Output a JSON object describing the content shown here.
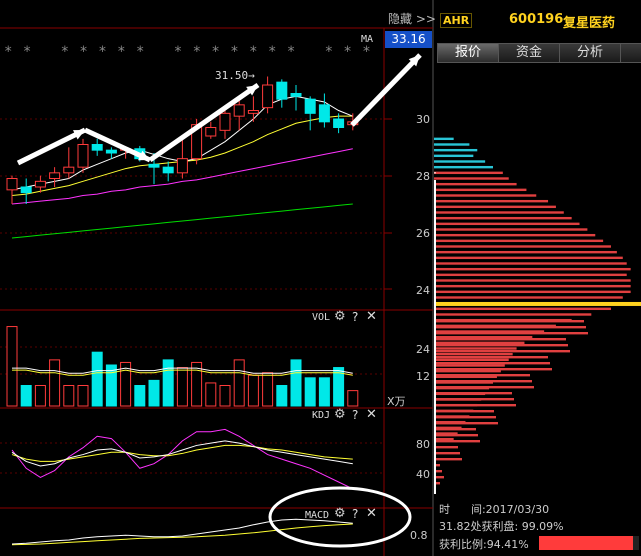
{
  "topbar": {
    "hide_button": "隐藏 >>"
  },
  "chart": {
    "stars": "* *   * * * * *   * * * * * * *   * * *",
    "ma_label": "MA",
    "price_badge": "33.16",
    "peak_label": "31.50→"
  },
  "price_axis": [
    "30",
    "28",
    "26",
    "24"
  ],
  "vol_axis": [
    "24",
    "12"
  ],
  "vol_unit": "X万",
  "kdj_axis": [
    "80",
    "40"
  ],
  "macd_axis": "0.8",
  "indicators": {
    "vol": "VOL",
    "kdj": "KDJ",
    "macd": "MACD",
    "help": "?",
    "close": "✕"
  },
  "stock": {
    "badge": "AHR",
    "code": "600196",
    "name": "复星医药"
  },
  "tabs": [
    "报价",
    "资金",
    "分析"
  ],
  "info": {
    "time_label": "时      间:2017/03/30",
    "profit_line": "31.82处获利盘: 99.09%",
    "ratio_line": "获利比例:94.41%"
  },
  "colors": {
    "up": "#ff3b3b",
    "down": "#00e8e8",
    "ma1": "#ffffff",
    "ma2": "#ffff33",
    "ma3": "#ff33ff",
    "ma4": "#00dd00",
    "accent": "#1550c8"
  },
  "chart_data": {
    "type": "candlestick",
    "candles": [
      {
        "o": 27.5,
        "h": 28.0,
        "l": 27.0,
        "c": 27.9
      },
      {
        "o": 27.6,
        "h": 27.9,
        "l": 27.0,
        "c": 27.4
      },
      {
        "o": 27.6,
        "h": 28.0,
        "l": 27.4,
        "c": 27.8
      },
      {
        "o": 27.9,
        "h": 28.3,
        "l": 27.6,
        "c": 28.1
      },
      {
        "o": 28.1,
        "h": 29.0,
        "l": 27.9,
        "c": 28.3
      },
      {
        "o": 28.3,
        "h": 29.3,
        "l": 28.1,
        "c": 29.1
      },
      {
        "o": 29.1,
        "h": 29.3,
        "l": 28.7,
        "c": 28.9
      },
      {
        "o": 28.9,
        "h": 29.0,
        "l": 28.6,
        "c": 28.8
      },
      {
        "o": 28.9,
        "h": 29.0,
        "l": 28.6,
        "c": 28.95
      },
      {
        "o": 28.95,
        "h": 29.05,
        "l": 28.5,
        "c": 28.6
      },
      {
        "o": 28.4,
        "h": 28.8,
        "l": 27.7,
        "c": 28.3
      },
      {
        "o": 28.3,
        "h": 28.5,
        "l": 27.8,
        "c": 28.1
      },
      {
        "o": 28.1,
        "h": 29.3,
        "l": 27.9,
        "c": 28.6
      },
      {
        "o": 28.6,
        "h": 30.0,
        "l": 28.4,
        "c": 29.8
      },
      {
        "o": 29.4,
        "h": 29.9,
        "l": 29.3,
        "c": 29.7
      },
      {
        "o": 29.6,
        "h": 30.3,
        "l": 29.3,
        "c": 30.2
      },
      {
        "o": 30.1,
        "h": 30.7,
        "l": 29.6,
        "c": 30.5
      },
      {
        "o": 30.2,
        "h": 30.8,
        "l": 29.9,
        "c": 30.3
      },
      {
        "o": 30.4,
        "h": 31.5,
        "l": 30.2,
        "c": 31.2
      },
      {
        "o": 31.3,
        "h": 31.4,
        "l": 30.4,
        "c": 30.7
      },
      {
        "o": 30.9,
        "h": 31.2,
        "l": 30.3,
        "c": 30.8
      },
      {
        "o": 30.7,
        "h": 30.8,
        "l": 29.6,
        "c": 30.2
      },
      {
        "o": 30.5,
        "h": 30.9,
        "l": 29.7,
        "c": 29.9
      },
      {
        "o": 30.0,
        "h": 30.2,
        "l": 29.5,
        "c": 29.7
      },
      {
        "o": 29.8,
        "h": 30.2,
        "l": 29.6,
        "c": 29.9
      }
    ],
    "ma5": [
      27.5,
      27.6,
      27.7,
      27.8,
      27.9,
      28.2,
      28.4,
      28.6,
      28.8,
      28.9,
      28.75,
      28.6,
      28.5,
      28.6,
      28.9,
      29.2,
      29.6,
      30.0,
      30.5,
      30.7,
      30.8,
      30.7,
      30.6,
      30.3,
      30.1
    ],
    "ma10": [
      27.3,
      27.35,
      27.45,
      27.55,
      27.65,
      27.8,
      27.95,
      28.1,
      28.25,
      28.35,
      28.4,
      28.45,
      28.5,
      28.55,
      28.65,
      28.8,
      29.0,
      29.2,
      29.45,
      29.65,
      29.85,
      29.95,
      30.05,
      30.1,
      30.1
    ],
    "ma20": [
      27.0,
      27.05,
      27.1,
      27.15,
      27.2,
      27.3,
      27.35,
      27.45,
      27.5,
      27.6,
      27.65,
      27.7,
      27.8,
      27.85,
      27.95,
      28.05,
      28.15,
      28.25,
      28.35,
      28.45,
      28.55,
      28.65,
      28.75,
      28.85,
      28.95
    ],
    "ma60": [
      25.8,
      25.85,
      25.9,
      25.95,
      26.0,
      26.05,
      26.1,
      26.15,
      26.2,
      26.25,
      26.3,
      26.35,
      26.4,
      26.45,
      26.5,
      26.55,
      26.6,
      26.65,
      26.7,
      26.75,
      26.8,
      26.85,
      26.9,
      26.95,
      27.0
    ],
    "volume": [
      31,
      8,
      8,
      18,
      8,
      8,
      21,
      16,
      17,
      8,
      10,
      18,
      15,
      17,
      9,
      8,
      18,
      12,
      13,
      8,
      18,
      11,
      11,
      15,
      6
    ],
    "vol_ma": [
      14,
      14,
      13,
      13,
      12,
      12,
      13,
      13,
      14,
      13,
      13,
      14,
      14,
      14,
      13,
      13,
      13,
      12,
      12,
      12,
      13,
      13,
      13,
      13,
      12
    ],
    "kdj_k": [
      60,
      52,
      48,
      50,
      55,
      58,
      62,
      63,
      60,
      55,
      56,
      58,
      62,
      66,
      68,
      70,
      68,
      65,
      62,
      60,
      58,
      56,
      54,
      52,
      50
    ],
    "kdj_d": [
      58,
      54,
      52,
      52,
      54,
      56,
      58,
      60,
      60,
      58,
      57,
      57,
      59,
      62,
      64,
      66,
      66,
      65,
      63,
      62,
      60,
      58,
      56,
      55,
      54
    ],
    "kdj_j": [
      62,
      46,
      38,
      44,
      56,
      64,
      74,
      72,
      60,
      46,
      50,
      58,
      70,
      78,
      78,
      80,
      74,
      66,
      58,
      54,
      50,
      46,
      40,
      34,
      28
    ],
    "macd_dif": [
      0.2,
      0.22,
      0.25,
      0.28,
      0.3,
      0.35,
      0.38,
      0.4,
      0.42,
      0.4,
      0.38,
      0.38,
      0.4,
      0.45,
      0.5,
      0.55,
      0.6,
      0.68,
      0.75,
      0.8,
      0.82,
      0.8,
      0.78,
      0.75,
      0.72
    ],
    "macd_dea": [
      0.18,
      0.19,
      0.2,
      0.22,
      0.24,
      0.26,
      0.28,
      0.3,
      0.32,
      0.34,
      0.35,
      0.36,
      0.37,
      0.38,
      0.4,
      0.42,
      0.45,
      0.48,
      0.52,
      0.56,
      0.6,
      0.63,
      0.66,
      0.68,
      0.7
    ],
    "chip_distribution": [
      {
        "price": 29.3,
        "v": 0.1,
        "type": "cyan"
      },
      {
        "price": 29.1,
        "v": 0.18,
        "type": "cyan"
      },
      {
        "price": 28.9,
        "v": 0.22,
        "type": "cyan"
      },
      {
        "price": 28.7,
        "v": 0.2,
        "type": "cyan"
      },
      {
        "price": 28.5,
        "v": 0.26,
        "type": "cyan"
      },
      {
        "price": 28.3,
        "v": 0.3,
        "type": "cyan"
      },
      {
        "price": 28.1,
        "v": 0.35,
        "type": "red"
      },
      {
        "price": 27.9,
        "v": 0.38,
        "type": "red"
      },
      {
        "price": 27.7,
        "v": 0.42,
        "type": "red"
      },
      {
        "price": 27.5,
        "v": 0.47,
        "type": "red"
      },
      {
        "price": 27.3,
        "v": 0.52,
        "type": "red"
      },
      {
        "price": 27.1,
        "v": 0.58,
        "type": "red"
      },
      {
        "price": 26.9,
        "v": 0.62,
        "type": "red"
      },
      {
        "price": 26.7,
        "v": 0.66,
        "type": "red"
      },
      {
        "price": 26.5,
        "v": 0.7,
        "type": "red"
      },
      {
        "price": 26.3,
        "v": 0.74,
        "type": "red"
      },
      {
        "price": 26.1,
        "v": 0.78,
        "type": "red"
      },
      {
        "price": 25.9,
        "v": 0.82,
        "type": "red"
      },
      {
        "price": 25.7,
        "v": 0.86,
        "type": "red"
      },
      {
        "price": 25.5,
        "v": 0.9,
        "type": "red"
      },
      {
        "price": 25.3,
        "v": 0.93,
        "type": "red"
      },
      {
        "price": 25.1,
        "v": 0.96,
        "type": "red"
      },
      {
        "price": 24.9,
        "v": 0.98,
        "type": "red"
      },
      {
        "price": 24.7,
        "v": 1.0,
        "type": "red"
      },
      {
        "price": 24.5,
        "v": 0.98,
        "type": "red"
      },
      {
        "price": 24.3,
        "v": 1.0,
        "type": "red"
      },
      {
        "price": 24.1,
        "v": 1.0,
        "type": "red"
      },
      {
        "price": 23.9,
        "v": 1.0,
        "type": "red"
      },
      {
        "price": 23.7,
        "v": 0.96,
        "type": "red"
      },
      {
        "price": 23.5,
        "v": 1.0,
        "type": "yellow"
      },
      {
        "price": 23.3,
        "v": 0.9,
        "type": "red"
      },
      {
        "price": 23.1,
        "v": 0.8,
        "type": "red"
      },
      {
        "price": 22.9,
        "v": 0.7,
        "type": "red"
      },
      {
        "price": 22.7,
        "v": 0.62,
        "type": "red"
      },
      {
        "price": 22.5,
        "v": 0.56,
        "type": "red"
      },
      {
        "price": 22.3,
        "v": 0.5,
        "type": "red"
      },
      {
        "price": 22.1,
        "v": 0.46,
        "type": "red"
      },
      {
        "price": 21.9,
        "v": 0.42,
        "type": "red"
      },
      {
        "price": 21.7,
        "v": 0.4,
        "type": "red"
      },
      {
        "price": 21.5,
        "v": 0.38,
        "type": "red"
      },
      {
        "price": 21.3,
        "v": 0.36,
        "type": "red"
      },
      {
        "price": 21.1,
        "v": 0.34,
        "type": "red"
      },
      {
        "price": 20.9,
        "v": 0.32,
        "type": "red"
      },
      {
        "price": 20.7,
        "v": 0.3,
        "type": "red"
      },
      {
        "price": 20.5,
        "v": 0.28,
        "type": "red"
      },
      {
        "price": 20.3,
        "v": 0.26,
        "type": "red"
      },
      {
        "price": 20.1,
        "v": 0.24,
        "type": "red"
      },
      {
        "price": 19.9,
        "v": 0.22,
        "type": "red"
      },
      {
        "price": 19.7,
        "v": 0.2,
        "type": "red"
      },
      {
        "price": 19.5,
        "v": 0.18,
        "type": "red"
      },
      {
        "price": 19.3,
        "v": 0.16,
        "type": "red"
      },
      {
        "price": 19.1,
        "v": 0.14,
        "type": "red"
      },
      {
        "price": 18.9,
        "v": 0.12,
        "type": "red"
      },
      {
        "price": 18.7,
        "v": 0.1,
        "type": "red"
      }
    ],
    "profit_ratio": 0.9441
  }
}
